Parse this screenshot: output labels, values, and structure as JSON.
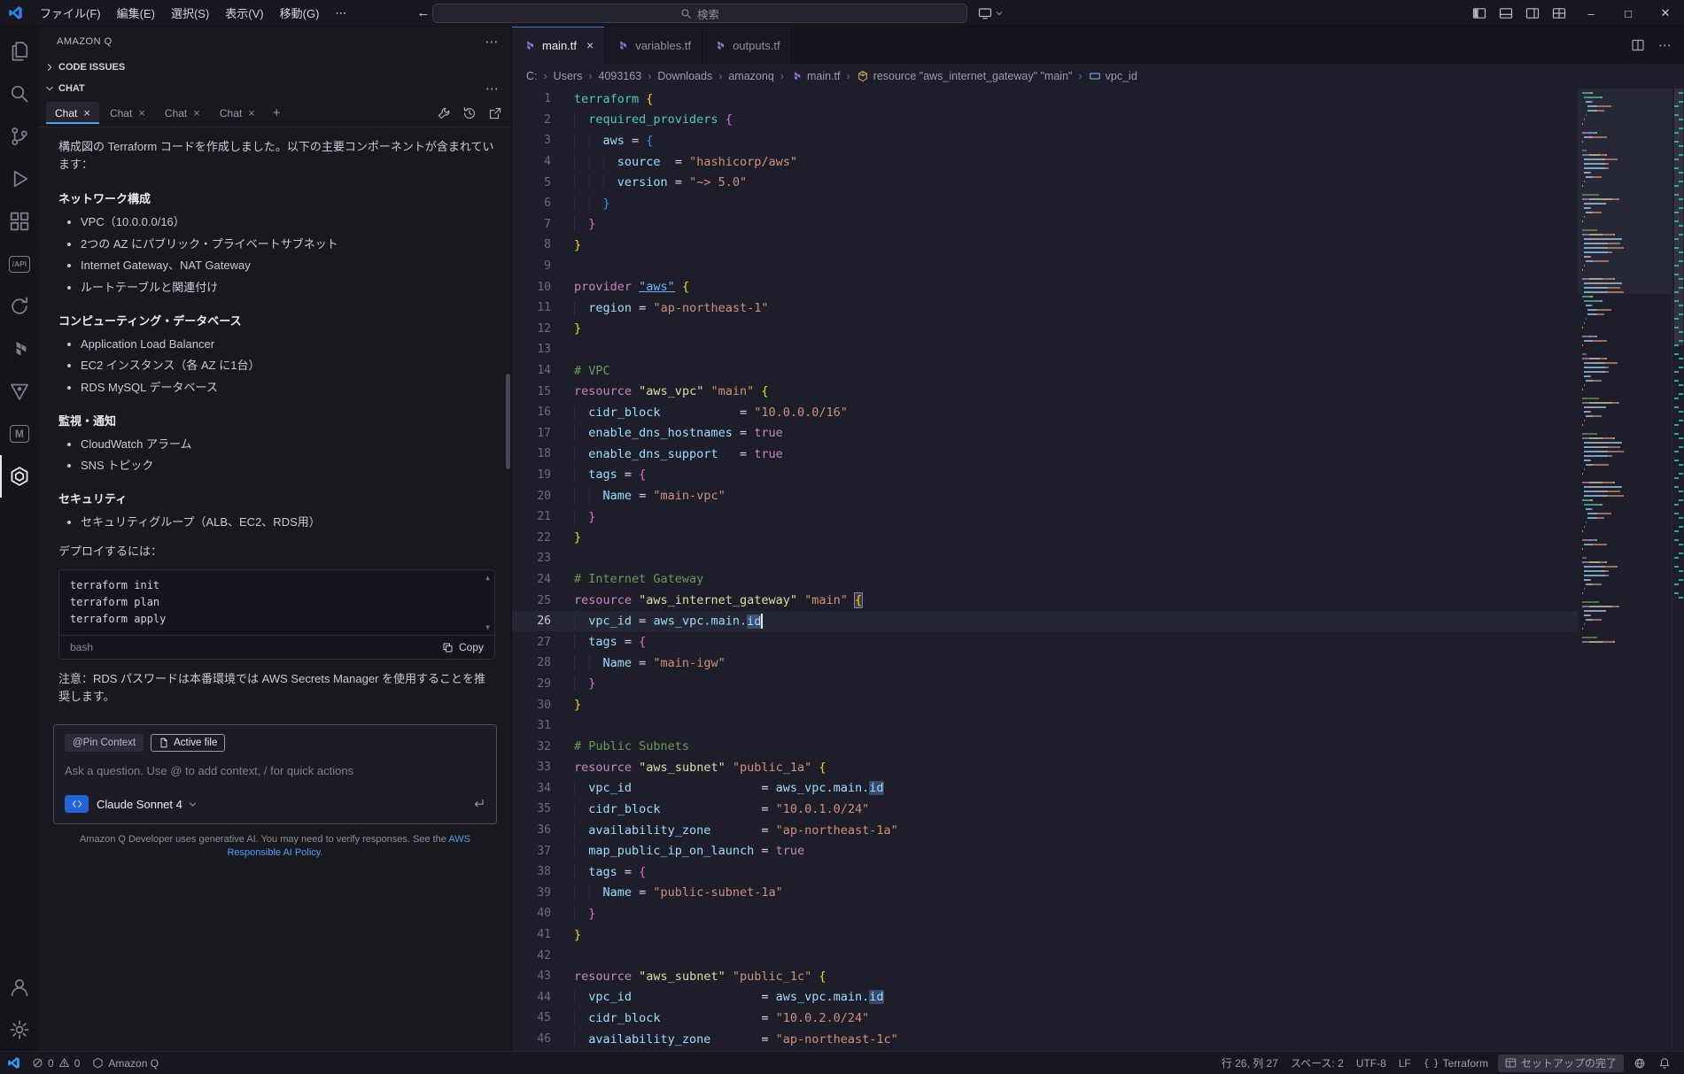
{
  "titlebar": {
    "menus": [
      "ファイル(F)",
      "編集(E)",
      "選択(S)",
      "表示(V)",
      "移動(G)"
    ],
    "search_placeholder": "検索"
  },
  "activity_bar": {
    "items": [
      {
        "name": "explorer-icon"
      },
      {
        "name": "search-icon"
      },
      {
        "name": "source-control-icon"
      },
      {
        "name": "run-debug-icon"
      },
      {
        "name": "extensions-icon"
      },
      {
        "name": "rest-api-icon",
        "label": "/API"
      },
      {
        "name": "sync-icon"
      },
      {
        "name": "terraform-icon"
      },
      {
        "name": "vault-icon"
      },
      {
        "name": "m-extension-icon",
        "label": "M"
      },
      {
        "name": "amazon-q-icon",
        "active": true
      },
      {
        "name": "accounts-icon",
        "bottom": true
      },
      {
        "name": "settings-icon",
        "bottom": true
      }
    ]
  },
  "sidebar": {
    "title": "AMAZON Q",
    "code_issues_label": "CODE ISSUES",
    "chat_label": "CHAT",
    "tabs": [
      {
        "label": "Chat",
        "active": true
      },
      {
        "label": "Chat"
      },
      {
        "label": "Chat"
      },
      {
        "label": "Chat"
      }
    ],
    "new_tab_label": "+",
    "chat": {
      "intro": "構成図の Terraform コードを作成しました。以下の主要コンポーネントが含まれています：",
      "sections": [
        {
          "heading": "ネットワーク構成",
          "items": [
            "VPC（10.0.0.0/16）",
            "2つの AZ にパブリック・プライベートサブネット",
            "Internet Gateway、NAT Gateway",
            "ルートテーブルと関連付け"
          ]
        },
        {
          "heading": "コンピューティング・データベース",
          "items": [
            "Application Load Balancer",
            "EC2 インスタンス（各 AZ に1台）",
            "RDS MySQL データベース"
          ]
        },
        {
          "heading": "監視・通知",
          "items": [
            "CloudWatch アラーム",
            "SNS トピック"
          ]
        },
        {
          "heading": "セキュリティ",
          "items": [
            "セキュリティグループ（ALB、EC2、RDS用）"
          ]
        }
      ],
      "deploy_label": "デプロイするには：",
      "code_block": {
        "lines": [
          "terraform init",
          "terraform plan",
          "terraform apply"
        ],
        "language": "bash",
        "copy_label": "Copy"
      },
      "note": "注意：RDS パスワードは本番環境では AWS Secrets Manager を使用することを推奨します。"
    },
    "input": {
      "pin_context_label": "@Pin Context",
      "active_file_label": "Active file",
      "placeholder": "Ask a question. Use @ to add context, / for quick actions",
      "model_label": "Claude Sonnet 4"
    },
    "disclaimer": {
      "prefix": "Amazon Q Developer uses generative AI. You may need to verify responses. See the ",
      "link": "AWS Responsible AI Policy",
      "suffix": "."
    }
  },
  "editor": {
    "tabs": [
      {
        "label": "main.tf",
        "active": true
      },
      {
        "label": "variables.tf"
      },
      {
        "label": "outputs.tf"
      }
    ],
    "breadcrumbs": [
      {
        "label": "C:"
      },
      {
        "label": "Users"
      },
      {
        "label": "4093163"
      },
      {
        "label": "Downloads"
      },
      {
        "label": "amazonq"
      },
      {
        "label": "main.tf",
        "icon": "tf-file"
      },
      {
        "label": "resource \"aws_internet_gateway\" \"main\"",
        "icon": "sym-resource"
      },
      {
        "label": "vpc_id",
        "icon": "sym-field"
      }
    ],
    "code": [
      {
        "n": 1,
        "seg": [
          [
            "t",
            "terraform"
          ],
          [
            "p",
            " "
          ],
          [
            "b1",
            "{"
          ]
        ]
      },
      {
        "n": 2,
        "seg": [
          [
            "i",
            "  "
          ],
          [
            "t",
            "required_providers"
          ],
          [
            "p",
            " "
          ],
          [
            "b2",
            "{"
          ]
        ]
      },
      {
        "n": 3,
        "seg": [
          [
            "i",
            "    "
          ],
          [
            "v",
            "aws"
          ],
          [
            "p",
            " = "
          ],
          [
            "b3",
            "{"
          ]
        ]
      },
      {
        "n": 4,
        "seg": [
          [
            "i",
            "      "
          ],
          [
            "v",
            "source"
          ],
          [
            "p",
            "  = "
          ],
          [
            "s",
            "\"hashicorp/aws\""
          ]
        ]
      },
      {
        "n": 5,
        "seg": [
          [
            "i",
            "      "
          ],
          [
            "v",
            "version"
          ],
          [
            "p",
            " = "
          ],
          [
            "s",
            "\"~> 5.0\""
          ]
        ]
      },
      {
        "n": 6,
        "seg": [
          [
            "i",
            "    "
          ],
          [
            "b3",
            "}"
          ]
        ]
      },
      {
        "n": 7,
        "seg": [
          [
            "i",
            "  "
          ],
          [
            "b2",
            "}"
          ]
        ]
      },
      {
        "n": 8,
        "seg": [
          [
            "b1",
            "}"
          ]
        ]
      },
      {
        "n": 9,
        "seg": []
      },
      {
        "n": 10,
        "seg": [
          [
            "k",
            "provider"
          ],
          [
            "p",
            " "
          ],
          [
            "lnk",
            "\"aws\""
          ],
          [
            "p",
            " "
          ],
          [
            "b1",
            "{"
          ]
        ]
      },
      {
        "n": 11,
        "seg": [
          [
            "i",
            "  "
          ],
          [
            "v",
            "region"
          ],
          [
            "p",
            " = "
          ],
          [
            "s",
            "\"ap-northeast-1\""
          ]
        ]
      },
      {
        "n": 12,
        "seg": [
          [
            "b1",
            "}"
          ]
        ]
      },
      {
        "n": 13,
        "seg": []
      },
      {
        "n": 14,
        "seg": [
          [
            "c",
            "# VPC"
          ]
        ]
      },
      {
        "n": 15,
        "seg": [
          [
            "k",
            "resource"
          ],
          [
            "p",
            " "
          ],
          [
            "y",
            "\"aws_vpc\""
          ],
          [
            "p",
            " "
          ],
          [
            "s",
            "\"main\""
          ],
          [
            "p",
            " "
          ],
          [
            "b1",
            "{"
          ]
        ]
      },
      {
        "n": 16,
        "seg": [
          [
            "i",
            "  "
          ],
          [
            "v",
            "cidr_block"
          ],
          [
            "p",
            "           = "
          ],
          [
            "s",
            "\"10.0.0.0/16\""
          ]
        ]
      },
      {
        "n": 17,
        "seg": [
          [
            "i",
            "  "
          ],
          [
            "v",
            "enable_dns_hostnames"
          ],
          [
            "p",
            " = "
          ],
          [
            "k",
            "true"
          ]
        ]
      },
      {
        "n": 18,
        "seg": [
          [
            "i",
            "  "
          ],
          [
            "v",
            "enable_dns_support"
          ],
          [
            "p",
            "   = "
          ],
          [
            "k",
            "true"
          ]
        ]
      },
      {
        "n": 19,
        "seg": [
          [
            "i",
            "  "
          ],
          [
            "v",
            "tags"
          ],
          [
            "p",
            " = "
          ],
          [
            "b2",
            "{"
          ]
        ]
      },
      {
        "n": 20,
        "seg": [
          [
            "i",
            "    "
          ],
          [
            "v",
            "Name"
          ],
          [
            "p",
            " = "
          ],
          [
            "s",
            "\"main-vpc\""
          ]
        ]
      },
      {
        "n": 21,
        "seg": [
          [
            "i",
            "  "
          ],
          [
            "b2",
            "}"
          ]
        ]
      },
      {
        "n": 22,
        "seg": [
          [
            "b1",
            "}"
          ]
        ]
      },
      {
        "n": 23,
        "seg": []
      },
      {
        "n": 24,
        "seg": [
          [
            "c",
            "# Internet Gateway"
          ]
        ]
      },
      {
        "n": 25,
        "seg": [
          [
            "k",
            "resource"
          ],
          [
            "p",
            " "
          ],
          [
            "y",
            "\"aws_internet_gateway\""
          ],
          [
            "p",
            " "
          ],
          [
            "s",
            "\"main\""
          ],
          [
            "p",
            " "
          ],
          [
            "b1m",
            "{"
          ]
        ]
      },
      {
        "n": 26,
        "cur": true,
        "seg": [
          [
            "i",
            "  "
          ],
          [
            "v",
            "vpc_id"
          ],
          [
            "p",
            " = "
          ],
          [
            "v",
            "aws_vpc.main."
          ],
          [
            "hl",
            "id"
          ],
          [
            "caret",
            ""
          ]
        ]
      },
      {
        "n": 27,
        "seg": [
          [
            "i",
            "  "
          ],
          [
            "v",
            "tags"
          ],
          [
            "p",
            " = "
          ],
          [
            "b2",
            "{"
          ]
        ]
      },
      {
        "n": 28,
        "seg": [
          [
            "i",
            "    "
          ],
          [
            "v",
            "Name"
          ],
          [
            "p",
            " = "
          ],
          [
            "s",
            "\"main-igw\""
          ]
        ]
      },
      {
        "n": 29,
        "seg": [
          [
            "i",
            "  "
          ],
          [
            "b2",
            "}"
          ]
        ]
      },
      {
        "n": 30,
        "seg": [
          [
            "b1",
            "}"
          ]
        ]
      },
      {
        "n": 31,
        "seg": []
      },
      {
        "n": 32,
        "seg": [
          [
            "c",
            "# Public Subnets"
          ]
        ]
      },
      {
        "n": 33,
        "seg": [
          [
            "k",
            "resource"
          ],
          [
            "p",
            " "
          ],
          [
            "y",
            "\"aws_subnet\""
          ],
          [
            "p",
            " "
          ],
          [
            "s",
            "\"public_1a\""
          ],
          [
            "p",
            " "
          ],
          [
            "b1",
            "{"
          ]
        ]
      },
      {
        "n": 34,
        "seg": [
          [
            "i",
            "  "
          ],
          [
            "v",
            "vpc_id"
          ],
          [
            "p",
            "                  = "
          ],
          [
            "v",
            "aws_vpc.main."
          ],
          [
            "hl",
            "id"
          ]
        ]
      },
      {
        "n": 35,
        "seg": [
          [
            "i",
            "  "
          ],
          [
            "v",
            "cidr_block"
          ],
          [
            "p",
            "              = "
          ],
          [
            "s",
            "\"10.0.1.0/24\""
          ]
        ]
      },
      {
        "n": 36,
        "seg": [
          [
            "i",
            "  "
          ],
          [
            "v",
            "availability_zone"
          ],
          [
            "p",
            "       = "
          ],
          [
            "s",
            "\"ap-northeast-1a\""
          ]
        ]
      },
      {
        "n": 37,
        "seg": [
          [
            "i",
            "  "
          ],
          [
            "v",
            "map_public_ip_on_launch"
          ],
          [
            "p",
            " = "
          ],
          [
            "k",
            "true"
          ]
        ]
      },
      {
        "n": 38,
        "seg": [
          [
            "i",
            "  "
          ],
          [
            "v",
            "tags"
          ],
          [
            "p",
            " = "
          ],
          [
            "b2",
            "{"
          ]
        ]
      },
      {
        "n": 39,
        "seg": [
          [
            "i",
            "    "
          ],
          [
            "v",
            "Name"
          ],
          [
            "p",
            " = "
          ],
          [
            "s",
            "\"public-subnet-1a\""
          ]
        ]
      },
      {
        "n": 40,
        "seg": [
          [
            "i",
            "  "
          ],
          [
            "b2",
            "}"
          ]
        ]
      },
      {
        "n": 41,
        "seg": [
          [
            "b1",
            "}"
          ]
        ]
      },
      {
        "n": 42,
        "seg": []
      },
      {
        "n": 43,
        "seg": [
          [
            "k",
            "resource"
          ],
          [
            "p",
            " "
          ],
          [
            "y",
            "\"aws_subnet\""
          ],
          [
            "p",
            " "
          ],
          [
            "s",
            "\"public_1c\""
          ],
          [
            "p",
            " "
          ],
          [
            "b1",
            "{"
          ]
        ]
      },
      {
        "n": 44,
        "seg": [
          [
            "i",
            "  "
          ],
          [
            "v",
            "vpc_id"
          ],
          [
            "p",
            "                  = "
          ],
          [
            "v",
            "aws_vpc.main."
          ],
          [
            "hl",
            "id"
          ]
        ]
      },
      {
        "n": 45,
        "seg": [
          [
            "i",
            "  "
          ],
          [
            "v",
            "cidr_block"
          ],
          [
            "p",
            "              = "
          ],
          [
            "s",
            "\"10.0.2.0/24\""
          ]
        ]
      },
      {
        "n": 46,
        "seg": [
          [
            "i",
            "  "
          ],
          [
            "v",
            "availability_zone"
          ],
          [
            "p",
            "       = "
          ],
          [
            "s",
            "\"ap-northeast-1c\""
          ]
        ]
      }
    ]
  },
  "statusbar": {
    "errors": "0",
    "warnings": "0",
    "amazon_q": "Amazon Q",
    "line_col": "行 26, 列 27",
    "indent": "スペース: 2",
    "encoding": "UTF-8",
    "eol": "LF",
    "language": "Terraform",
    "setup": "セットアップの完了"
  }
}
